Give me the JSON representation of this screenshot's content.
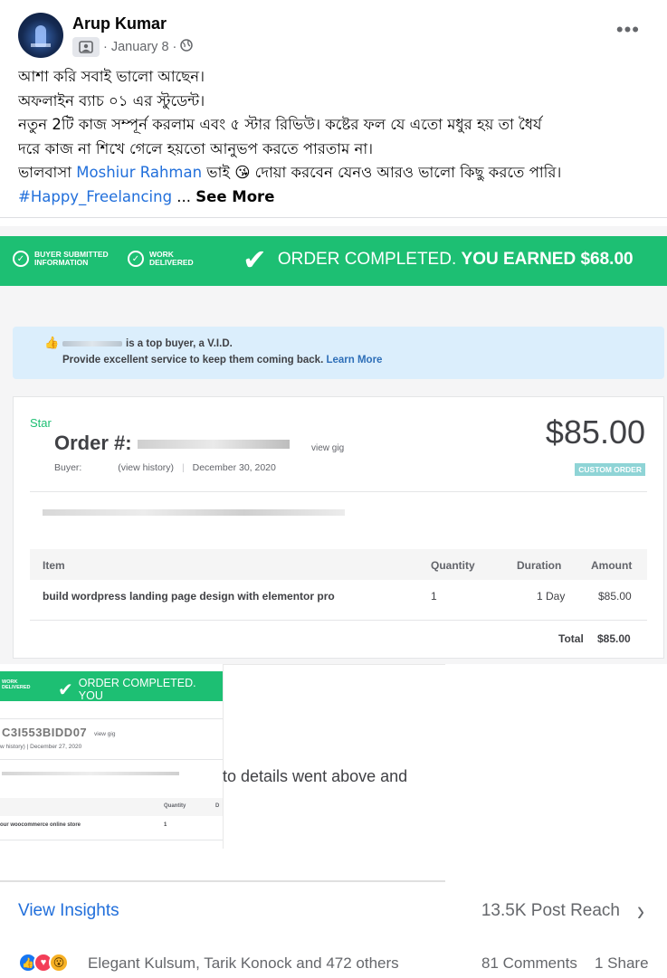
{
  "post": {
    "author": "Arup Kumar",
    "date": "January 8",
    "separator": "·",
    "text_lines": [
      "আশা করি সবাই ভালো আছেন।",
      "অফলাইন ব্যাচ ০১ এর স্টুডেন্ট।",
      "নতুন 2টি কাজ সম্পূর্ন করলাম এবং ৫ স্টার রিভিউ। কষ্টের ফল যে এতো মধুর হয় তা ধৈর্য",
      "দরে কাজ না শিখে গেলে হয়তো আনুভপ করতে পারতাম না।"
    ],
    "line5_prefix": "ভালবাসা ",
    "mention": "Moshiur Rahman",
    "line5_suffix": " ভাই 😘 দোয়া করবেন যেনও আরও ভালো কিছু করতে পারি।",
    "hashtag": "#Happy_Freelancing",
    "ellipsis": " ... ",
    "see_more": "See More"
  },
  "image": {
    "steps": [
      {
        "line1": "BUYER SUBMITTED",
        "line2": "INFORMATION"
      },
      {
        "line1": "WORK",
        "line2": "DELIVERED"
      }
    ],
    "completed_text": "ORDER COMPLETED.",
    "earned_text": "YOU EARNED $68.00",
    "vid_line1": "is a top buyer, a V.I.D.",
    "vid_line2": "Provide excellent service to keep them coming back.",
    "learn_more": "Learn More",
    "star": "Star",
    "order_label": "Order #:",
    "view_gig": "view gig",
    "price": "$85.00",
    "buyer_label": "Buyer:",
    "view_history": "(view history)",
    "order_date": "December 30, 2020",
    "custom_order": "CUSTOM ORDER",
    "table": {
      "headers": [
        "Item",
        "Quantity",
        "Duration",
        "Amount"
      ],
      "row": [
        "build wordpress landing page design with elementor pro",
        "1",
        "1 Day",
        "$85.00"
      ],
      "total_label": "Total",
      "total_value": "$85.00"
    },
    "second": {
      "work": "WORK",
      "delivered": "DELIVERED",
      "completed": "ORDER COMPLETED. YOU",
      "order_id": "C3I553BIDD07",
      "view_gig": "view gig",
      "history": "w history)",
      "date": "December 27, 2020",
      "quantity_header": "Quantity",
      "d_header": "D",
      "row_item": "our woocommerce online store",
      "row_qty": "1",
      "details_text": "to details went above and"
    }
  },
  "footer": {
    "view_insights": "View Insights",
    "post_reach": "13.5K Post Reach",
    "reaction_names": "Elegant Kulsum, Tarik Konock and 472 others",
    "comments": "81 Comments",
    "shares": "1 Share"
  }
}
